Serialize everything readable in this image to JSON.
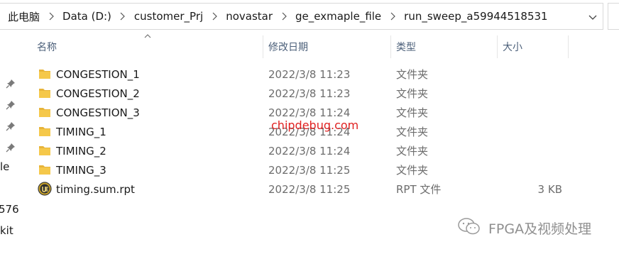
{
  "address_bar": {
    "crumbs": [
      "此电脑",
      "Data (D:)",
      "customer_Prj",
      "novastar",
      "ge_exmaple_file",
      "run_sweep_a59944518531"
    ]
  },
  "columns": {
    "name": "名称",
    "date": "修改日期",
    "type": "类型",
    "size": "大小"
  },
  "files": [
    {
      "name": "CONGESTION_1",
      "date": "2022/3/8 11:23",
      "type": "文件夹",
      "size": "",
      "icon": "folder-icon"
    },
    {
      "name": "CONGESTION_2",
      "date": "2022/3/8 11:23",
      "type": "文件夹",
      "size": "",
      "icon": "folder-icon"
    },
    {
      "name": "CONGESTION_3",
      "date": "2022/3/8 11:24",
      "type": "文件夹",
      "size": "",
      "icon": "folder-icon"
    },
    {
      "name": "TIMING_1",
      "date": "2022/3/8 11:24",
      "type": "文件夹",
      "size": "",
      "icon": "folder-icon"
    },
    {
      "name": "TIMING_2",
      "date": "2022/3/8 11:24",
      "type": "文件夹",
      "size": "",
      "icon": "folder-icon"
    },
    {
      "name": "TIMING_3",
      "date": "2022/3/8 11:25",
      "type": "文件夹",
      "size": "",
      "icon": "folder-icon"
    },
    {
      "name": "timing.sum.rpt",
      "date": "2022/3/8 11:25",
      "type": "RPT 文件",
      "size": "3 KB",
      "icon": "rpt-file-icon"
    }
  ],
  "nav_fragments": [
    "le",
    "576",
    "kit"
  ],
  "watermarks": {
    "site": "chipdebug.com",
    "brand": "FPGA及视频处理"
  },
  "colors": {
    "folder": "#f0c33c",
    "header_text": "#4c607a",
    "watermark_red": "#e02020"
  }
}
